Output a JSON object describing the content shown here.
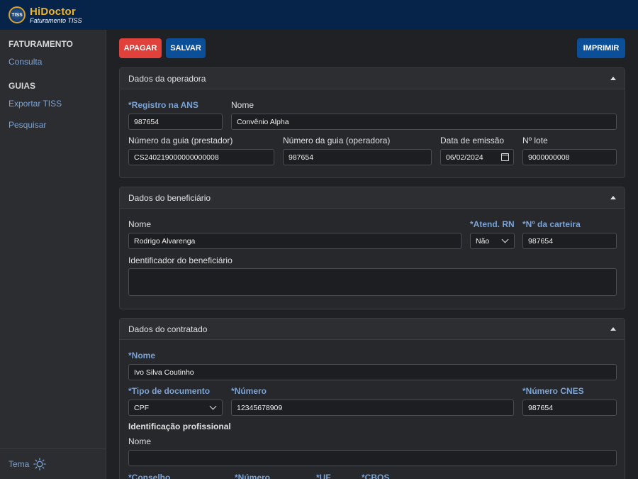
{
  "app": {
    "logo_text": "TISS",
    "name": "HiDoctor",
    "subtitle": "Faturamento TISS"
  },
  "sidebar": {
    "sections": [
      {
        "title": "FATURAMENTO",
        "items": [
          "Consulta"
        ]
      },
      {
        "title": "GUIAS",
        "items": [
          "Exportar TISS",
          "Pesquisar"
        ]
      }
    ],
    "theme_label": "Tema"
  },
  "toolbar": {
    "delete_label": "APAGAR",
    "save_label": "SALVAR",
    "print_label": "IMPRIMIR"
  },
  "operadora": {
    "title": "Dados da operadora",
    "registro_label": "*Registro na ANS",
    "registro_value": "987654",
    "nome_label": "Nome",
    "nome_value": "Convênio Alpha",
    "guia_prestador_label": "Número da guia (prestador)",
    "guia_prestador_value": "CS240219000000000008",
    "guia_operadora_label": "Número da guia (operadora)",
    "guia_operadora_value": "987654",
    "emissao_label": "Data de emissão",
    "emissao_value": "06/02/2024",
    "lote_label": "Nº lote",
    "lote_value": "9000000008"
  },
  "beneficiario": {
    "title": "Dados do beneficiário",
    "nome_label": "Nome",
    "nome_value": "Rodrigo Alvarenga",
    "atend_label": "*Atend. RN",
    "atend_value": "Não",
    "carteira_label": "*Nº da carteira",
    "carteira_value": "987654",
    "identificador_label": "Identificador do beneficiário",
    "identificador_value": ""
  },
  "contratado": {
    "title": "Dados do contratado",
    "nome_label": "*Nome",
    "nome_value": "Ivo Silva Coutinho",
    "tipo_doc_label": "*Tipo de documento",
    "tipo_doc_value": "CPF",
    "numero_label": "*Número",
    "numero_value": "12345678909",
    "cnes_label": "*Número CNES",
    "cnes_value": "987654",
    "ident_prof_label": "Identificação profissional",
    "prof_nome_label": "Nome",
    "prof_nome_value": "",
    "conselho_label": "*Conselho",
    "prof_numero_label": "*Número",
    "uf_label": "*UF",
    "cbos_label": "*CBOS"
  }
}
